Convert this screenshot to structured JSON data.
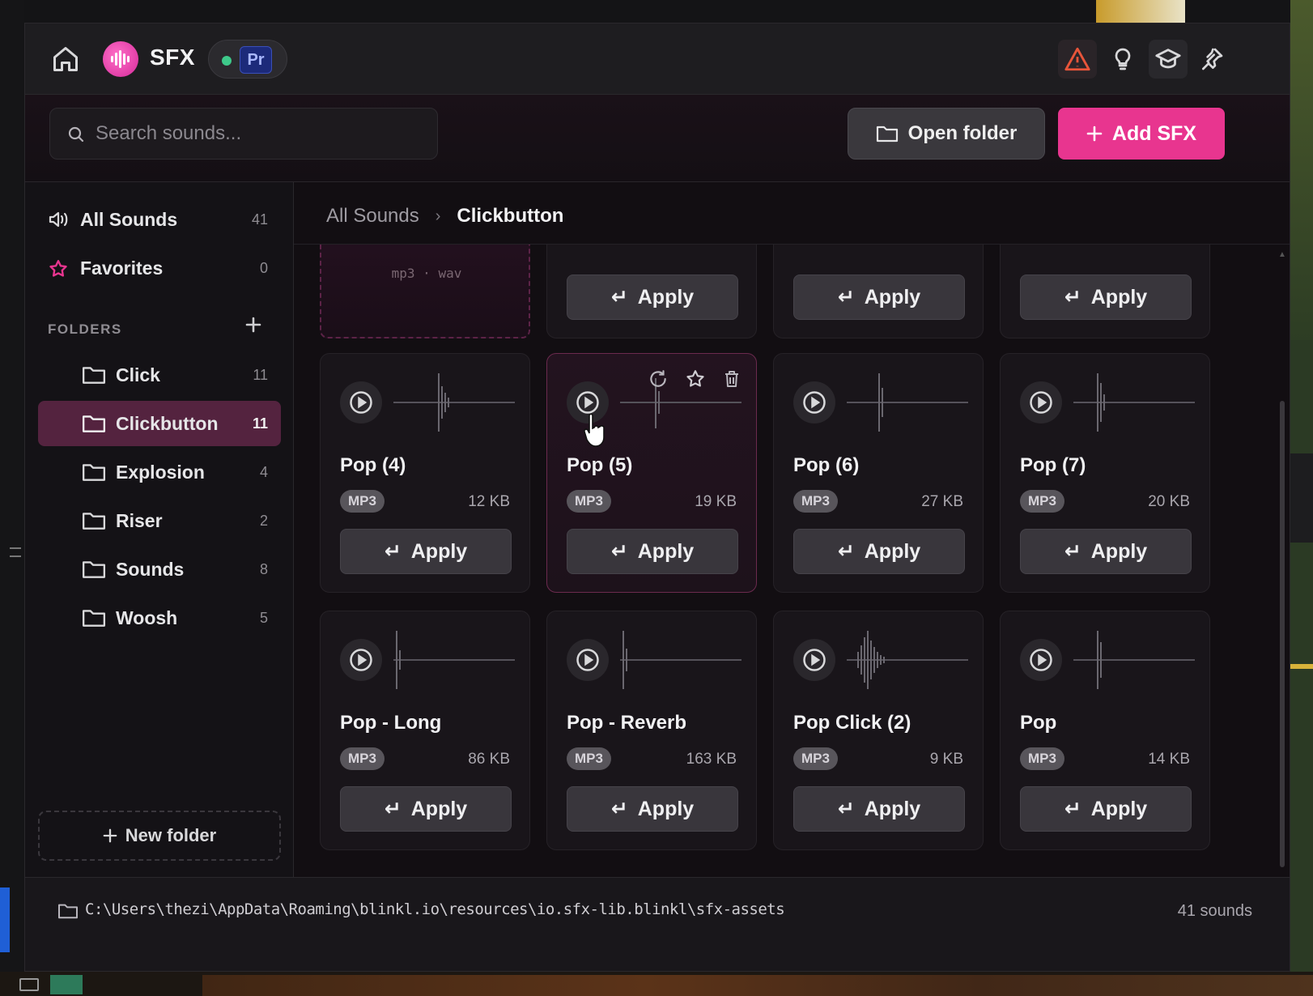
{
  "app": {
    "title": "SFX",
    "host_badge": "Pr",
    "host_status_color": "#3ec98a",
    "accent_color": "#e8358f"
  },
  "titlebar": {
    "icons": [
      "home-icon",
      "warning-icon",
      "lightbulb-icon",
      "graduation-cap-icon",
      "pin-icon"
    ]
  },
  "toolbar": {
    "search_placeholder": "Search sounds...",
    "open_folder_label": "Open folder",
    "add_sfx_label": "Add SFX"
  },
  "sidebar": {
    "all_sounds": {
      "label": "All Sounds",
      "count": "41"
    },
    "favorites": {
      "label": "Favorites",
      "count": "0"
    },
    "folders_heading": "FOLDERS",
    "folders": [
      {
        "label": "Click",
        "count": "11",
        "active": false
      },
      {
        "label": "Clickbutton",
        "count": "11",
        "active": true
      },
      {
        "label": "Explosion",
        "count": "4",
        "active": false
      },
      {
        "label": "Riser",
        "count": "2",
        "active": false
      },
      {
        "label": "Sounds",
        "count": "8",
        "active": false
      },
      {
        "label": "Woosh",
        "count": "5",
        "active": false
      }
    ],
    "new_folder_label": "New folder"
  },
  "breadcrumb": {
    "root": "All Sounds",
    "current": "Clickbutton"
  },
  "drop_zone": {
    "formats": "mp3 · wav"
  },
  "apply_label": "Apply",
  "sounds": [
    {
      "name": "Pop (4)",
      "format": "MP3",
      "size": "12 KB"
    },
    {
      "name": "Pop (5)",
      "format": "MP3",
      "size": "19 KB",
      "hovered": true
    },
    {
      "name": "Pop (6)",
      "format": "MP3",
      "size": "27 KB"
    },
    {
      "name": "Pop (7)",
      "format": "MP3",
      "size": "20 KB"
    },
    {
      "name": "Pop - Long",
      "format": "MP3",
      "size": "86 KB"
    },
    {
      "name": "Pop - Reverb",
      "format": "MP3",
      "size": "163 KB"
    },
    {
      "name": "Pop Click (2)",
      "format": "MP3",
      "size": "9 KB"
    },
    {
      "name": "Pop",
      "format": "MP3",
      "size": "14 KB"
    }
  ],
  "statusbar": {
    "path": "C:\\Users\\thezi\\AppData\\Roaming\\blinkl.io\\resources\\io.sfx-lib.blinkl\\sfx-assets",
    "total": "41 sounds"
  }
}
